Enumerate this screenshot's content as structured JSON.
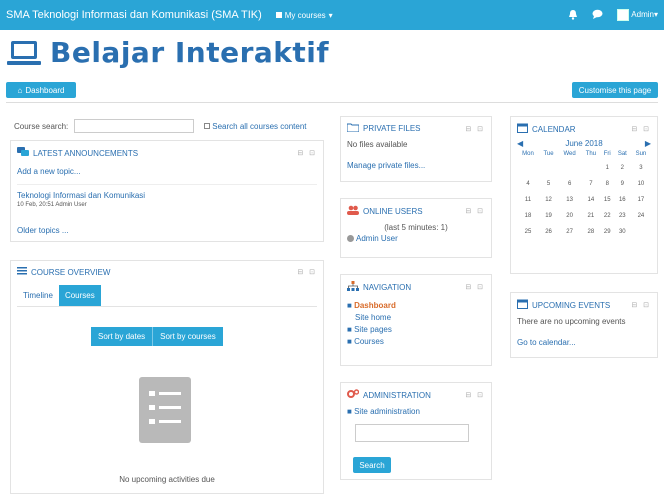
{
  "topbar": {
    "site_name": "SMA Teknologi Informasi dan Komunikasi (SMA TIK)",
    "my_courses": "My courses",
    "user_menu": "Admin"
  },
  "header": {
    "title": "Belajar Interaktif",
    "dashboard_button": "Dashboard",
    "customise_button": "Customise this page"
  },
  "search": {
    "label": "Course search:",
    "link": "Search all courses content"
  },
  "announcements": {
    "title": "LATEST ANNOUNCEMENTS",
    "add_link": "Add a new topic...",
    "item_title": "Teknologi Informasi dan Komunikasi",
    "item_meta": "10 Feb, 20:51 Admin User",
    "older": "Older topics ..."
  },
  "overview": {
    "title": "COURSE OVERVIEW",
    "tabs": [
      "Timeline",
      "Courses"
    ],
    "sort": [
      "Sort by dates",
      "Sort by courses"
    ],
    "empty": "No upcoming activities due"
  },
  "private_files": {
    "title": "PRIVATE FILES",
    "empty": "No files available",
    "manage": "Manage private files..."
  },
  "online_users": {
    "title": "ONLINE USERS",
    "period": "(last 5 minutes: 1)",
    "user": "Admin User"
  },
  "navigation": {
    "title": "NAVIGATION",
    "items": [
      "Dashboard",
      "Site home",
      "Site pages",
      "Courses"
    ]
  },
  "administration": {
    "title": "ADMINISTRATION",
    "item": "Site administration",
    "search_button": "Search"
  },
  "calendar": {
    "title": "CALENDAR",
    "month": "June 2018",
    "days": [
      "Mon",
      "Tue",
      "Wed",
      "Thu",
      "Fri",
      "Sat",
      "Sun"
    ],
    "rows": [
      [
        "",
        "",
        "",
        "",
        "1",
        "2",
        "3"
      ],
      [
        "4",
        "5",
        "6",
        "7",
        "8",
        "9",
        "10"
      ],
      [
        "11",
        "12",
        "13",
        "14",
        "15",
        "16",
        "17"
      ],
      [
        "18",
        "19",
        "20",
        "21",
        "22",
        "23",
        "24"
      ],
      [
        "25",
        "26",
        "27",
        "28",
        "29",
        "30",
        ""
      ]
    ]
  },
  "upcoming": {
    "title": "UPCOMING EVENTS",
    "empty": "There are no upcoming events",
    "goto": "Go to calendar..."
  },
  "colors": {
    "accent": "#2aa5d6",
    "title": "#2a6fb0"
  }
}
